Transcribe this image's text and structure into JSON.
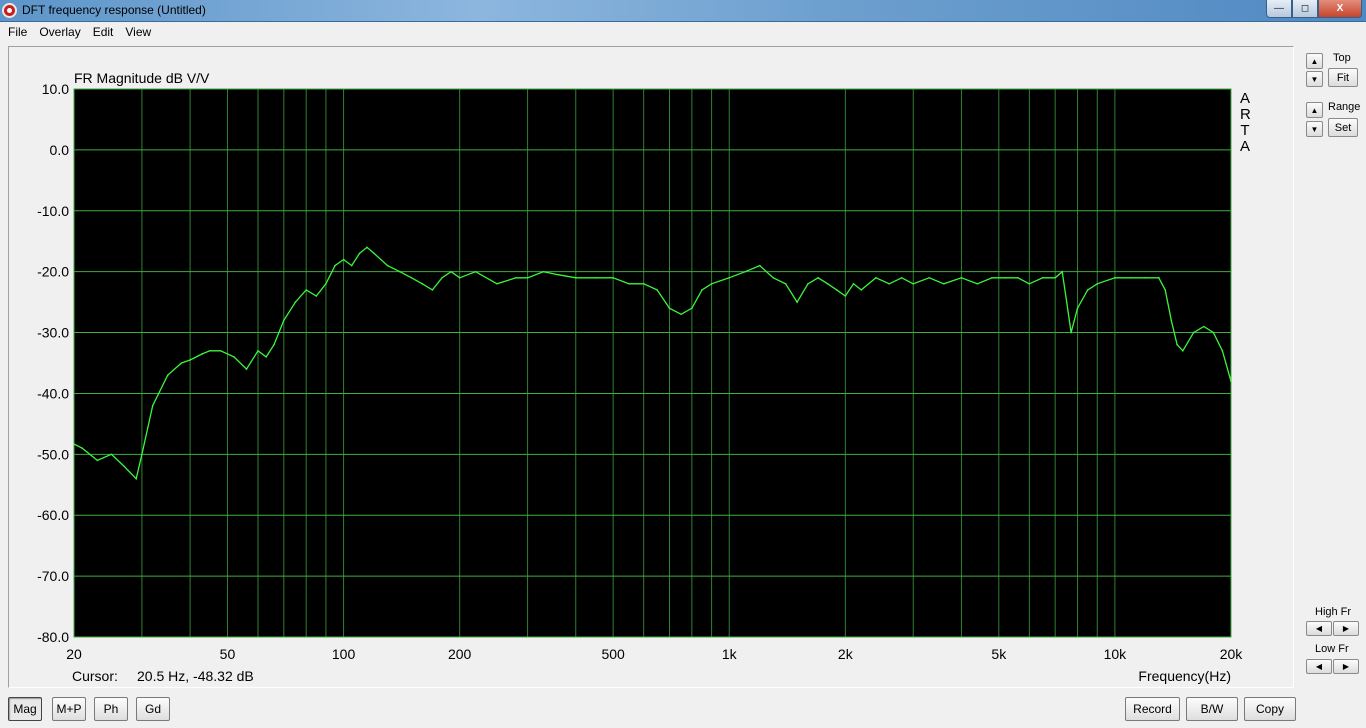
{
  "window": {
    "title": "DFT frequency response (Untitled)",
    "buttons": {
      "minimize": "—",
      "maximize": "◻",
      "close": "X"
    }
  },
  "menu": [
    "File",
    "Overlay",
    "Edit",
    "View"
  ],
  "plot": {
    "title": "FR Magnitude dB V/V",
    "watermark": [
      "A",
      "R",
      "T",
      "A"
    ],
    "cursor_label": "Cursor:",
    "cursor_value": "20.5 Hz, -48.32 dB",
    "xlabel": "Frequency(Hz)",
    "colors": {
      "background": "#000000",
      "grid": "#3fae3f",
      "trace": "#3cf53c"
    }
  },
  "chart_data": {
    "type": "line",
    "title": "FR Magnitude dB V/V",
    "xlabel": "Frequency(Hz)",
    "ylabel": "dB",
    "x_scale": "log",
    "xlim": [
      20,
      20000
    ],
    "ylim": [
      -80,
      10
    ],
    "grid": true,
    "x_ticks": [
      20,
      50,
      100,
      200,
      500,
      1000,
      2000,
      5000,
      10000,
      20000
    ],
    "x_tick_labels": [
      "20",
      "50",
      "100",
      "200",
      "500",
      "1k",
      "2k",
      "5k",
      "10k",
      "20k"
    ],
    "y_ticks": [
      10,
      0,
      -10,
      -20,
      -30,
      -40,
      -50,
      -60,
      -70,
      -80
    ],
    "y_tick_labels": [
      "10.0",
      "0.0",
      "-10.0",
      "-20.0",
      "-30.0",
      "-40.0",
      "-50.0",
      "-60.0",
      "-70.0",
      "-80.0"
    ],
    "series": [
      {
        "color": "#3cf53c",
        "x": [
          20,
          21,
          23,
          25,
          27,
          29,
          30,
          32,
          35,
          38,
          40,
          43,
          45,
          48,
          52,
          56,
          60,
          63,
          66,
          70,
          75,
          80,
          85,
          90,
          95,
          100,
          105,
          110,
          115,
          120,
          130,
          140,
          150,
          160,
          170,
          180,
          190,
          200,
          220,
          250,
          280,
          300,
          330,
          360,
          400,
          450,
          500,
          550,
          600,
          650,
          700,
          750,
          800,
          850,
          900,
          1000,
          1100,
          1200,
          1300,
          1400,
          1500,
          1600,
          1700,
          1800,
          1900,
          2000,
          2100,
          2200,
          2400,
          2600,
          2800,
          3000,
          3300,
          3600,
          4000,
          4400,
          4800,
          5200,
          5600,
          6000,
          6500,
          7000,
          7300,
          7500,
          7700,
          8000,
          8500,
          9000,
          10000,
          11000,
          12000,
          13000,
          13500,
          14000,
          14500,
          15000,
          16000,
          17000,
          18000,
          19000,
          20000
        ],
        "y": [
          -48.3,
          -49,
          -51,
          -50,
          -52,
          -54,
          -50,
          -42,
          -37,
          -35,
          -34.5,
          -33.5,
          -33,
          -33,
          -34,
          -36,
          -33,
          -34,
          -32,
          -28,
          -25,
          -23,
          -24,
          -22,
          -19,
          -18,
          -19,
          -17,
          -16,
          -17,
          -19,
          -20,
          -21,
          -22,
          -23,
          -21,
          -20,
          -21,
          -20,
          -22,
          -21,
          -21,
          -20,
          -20.5,
          -21,
          -21,
          -21,
          -22,
          -22,
          -23,
          -26,
          -27,
          -26,
          -23,
          -22,
          -21,
          -20,
          -19,
          -21,
          -22,
          -25,
          -22,
          -21,
          -22,
          -23,
          -24,
          -22,
          -23,
          -21,
          -22,
          -21,
          -22,
          -21,
          -22,
          -21,
          -22,
          -21,
          -21,
          -21,
          -22,
          -21,
          -21,
          -20,
          -25,
          -30,
          -26,
          -23,
          -22,
          -21,
          -21,
          -21,
          -21,
          -23,
          -28,
          -32,
          -33,
          -30,
          -29,
          -30,
          -33,
          -38
        ]
      }
    ]
  },
  "right_panel": {
    "top_label": "Top",
    "fit_label": "Fit",
    "range_label": "Range",
    "set_label": "Set",
    "high_fr_label": "High Fr",
    "low_fr_label": "Low Fr",
    "up_arrow": "▲",
    "down_arrow": "▼",
    "left_arrow": "◀",
    "right_arrow": "▶"
  },
  "toolbar": {
    "mag": "Mag",
    "mp": "M+P",
    "ph": "Ph",
    "gd": "Gd",
    "record": "Record",
    "bw": "B/W",
    "copy": "Copy"
  }
}
